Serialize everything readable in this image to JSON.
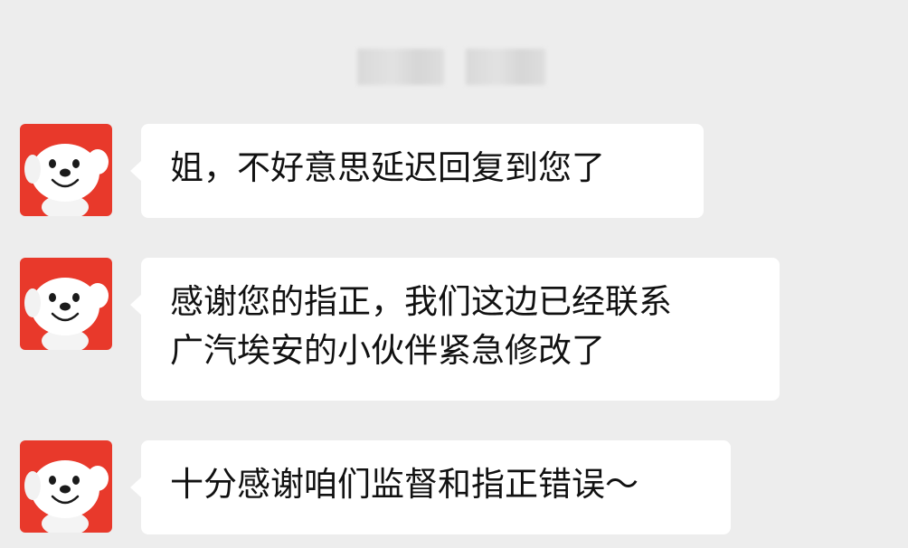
{
  "chat": {
    "messages": [
      {
        "sender_avatar": "jd-dog-avatar",
        "lines": [
          "姐，不好意思延迟回复到您了"
        ]
      },
      {
        "sender_avatar": "jd-dog-avatar",
        "lines": [
          "感谢您的指正，我们这边已经联系",
          "广汽埃安的小伙伴紧急修改了"
        ]
      },
      {
        "sender_avatar": "jd-dog-avatar",
        "lines": [
          "十分感谢咱们监督和指正错误～"
        ]
      }
    ]
  },
  "colors": {
    "background": "#ededed",
    "bubble": "#ffffff",
    "avatar_bg": "#e8392b",
    "text": "#111111"
  }
}
